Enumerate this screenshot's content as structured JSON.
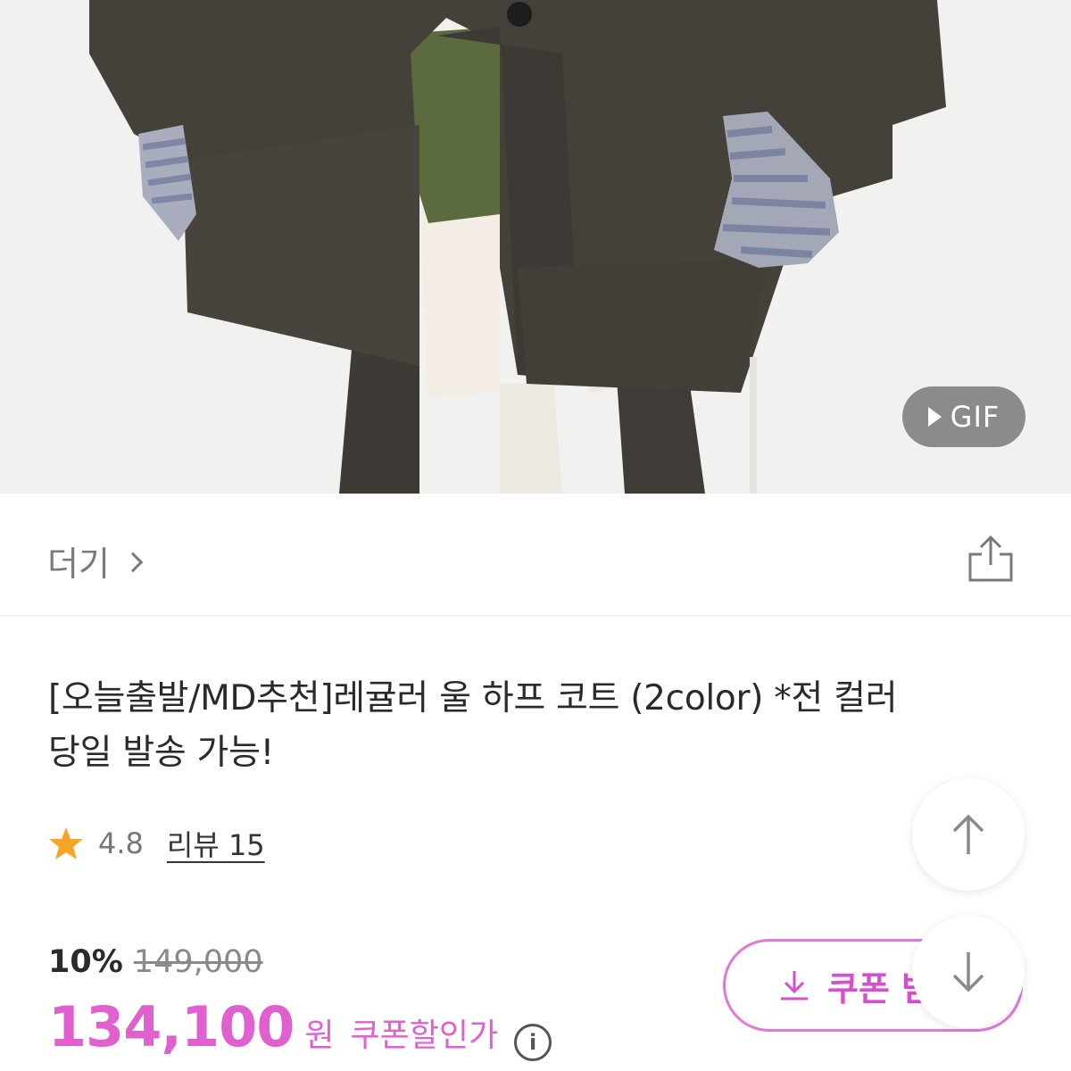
{
  "hero": {
    "gif_badge_label": "GIF",
    "icon": "play-icon"
  },
  "brand": {
    "name": "더기",
    "icon": "chevron-right-icon",
    "share_icon": "share-icon"
  },
  "product": {
    "title_line1": "[오늘출발/MD추천]레귤러 울 하프 코트 (2color) *전 컬러",
    "title_line2": "당일 발송 가능!",
    "rating": "4.8",
    "review_label": "리뷰 15"
  },
  "price": {
    "discount_rate": "10%",
    "original_price": "149,000",
    "sale_price": "134,100",
    "currency": "원",
    "coupon_label": "쿠폰할인가",
    "info_icon": "i"
  },
  "coupon_button": {
    "label": "쿠폰 받",
    "icon": "download-icon"
  },
  "floating": {
    "up_icon": "arrow-up-icon",
    "down_icon": "arrow-down-icon"
  },
  "colors": {
    "accent": "#e060d0",
    "text": "#2a2a2a",
    "muted": "#7a7a7a"
  }
}
